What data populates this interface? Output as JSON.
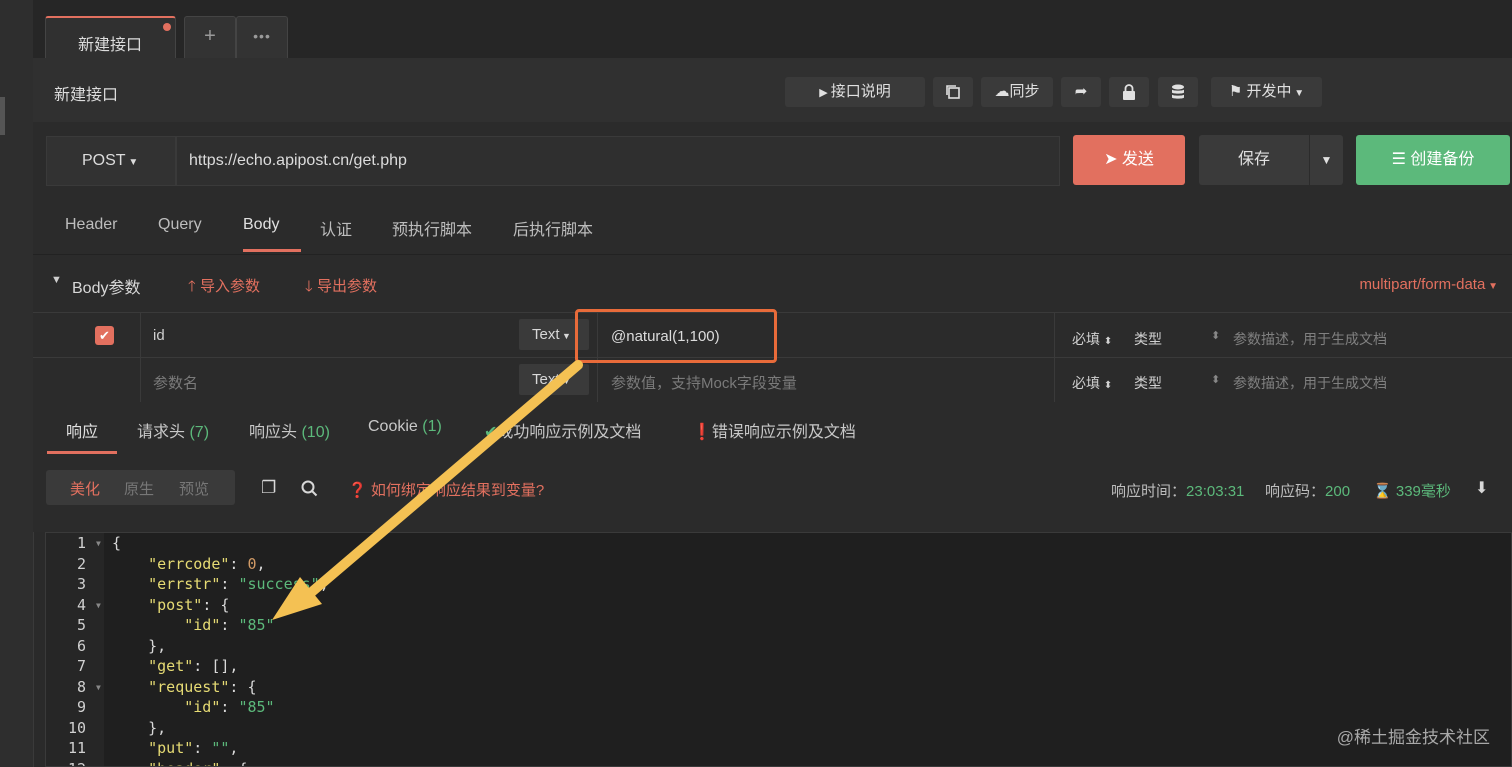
{
  "tabs": {
    "active_label": "新建接口",
    "plus": "+",
    "more": "•••"
  },
  "header": {
    "title": "新建接口",
    "doc_button": "接口说明",
    "sync_button": "同步",
    "env_status": "开发中"
  },
  "request": {
    "method": "POST",
    "url": "https://echo.apipost.cn/get.php",
    "send_label": "发送",
    "save_label": "保存",
    "backup_label": "创建备份"
  },
  "req_tabs": [
    "Header",
    "Query",
    "Body",
    "认证",
    "预执行脚本",
    "后执行脚本"
  ],
  "body_bar": {
    "title": "Body参数",
    "import_label": "导入参数",
    "export_label": "导出参数",
    "content_type": "multipart/form-data"
  },
  "params": {
    "rows": [
      {
        "name": "id",
        "type": "Text",
        "value": "@natural(1,100)",
        "required": "必填",
        "type_label": "类型",
        "desc_placeholder": "参数描述，用于生成文档"
      },
      {
        "name_placeholder": "参数名",
        "type": "Text",
        "value_placeholder": "参数值，支持Mock字段变量",
        "required": "必填",
        "type_label": "类型",
        "desc_placeholder": "参数描述，用于生成文档"
      }
    ]
  },
  "resp_tabs": {
    "response": "响应",
    "req_headers": "请求头",
    "req_headers_count": "(7)",
    "resp_headers": "响应头",
    "resp_headers_count": "(10)",
    "cookie": "Cookie",
    "cookie_count": "(1)",
    "success_doc": "成功响应示例及文档",
    "error_doc": "错误响应示例及文档"
  },
  "resp_toolbar": {
    "view_pretty": "美化",
    "view_raw": "原生",
    "view_preview": "预览",
    "help_link": "如何绑定响应结果到变量?",
    "time_label": "响应时间：",
    "time_value": "23:03:31",
    "code_label": "响应码：",
    "code_value": "200",
    "duration": "339毫秒"
  },
  "code_lines": [
    "{",
    "    \"errcode\": 0,",
    "    \"errstr\": \"success\",",
    "    \"post\": {",
    "        \"id\": \"85\"",
    "    },",
    "    \"get\": [],",
    "    \"request\": {",
    "        \"id\": \"85\"",
    "    },",
    "    \"put\": \"\",",
    "    \"header\": {"
  ],
  "watermark": "@稀土掘金技术社区",
  "colors": {
    "accent": "#e2705f",
    "green": "#5cb97b",
    "highlight": "#e86b3a",
    "arrow": "#f4c153"
  }
}
